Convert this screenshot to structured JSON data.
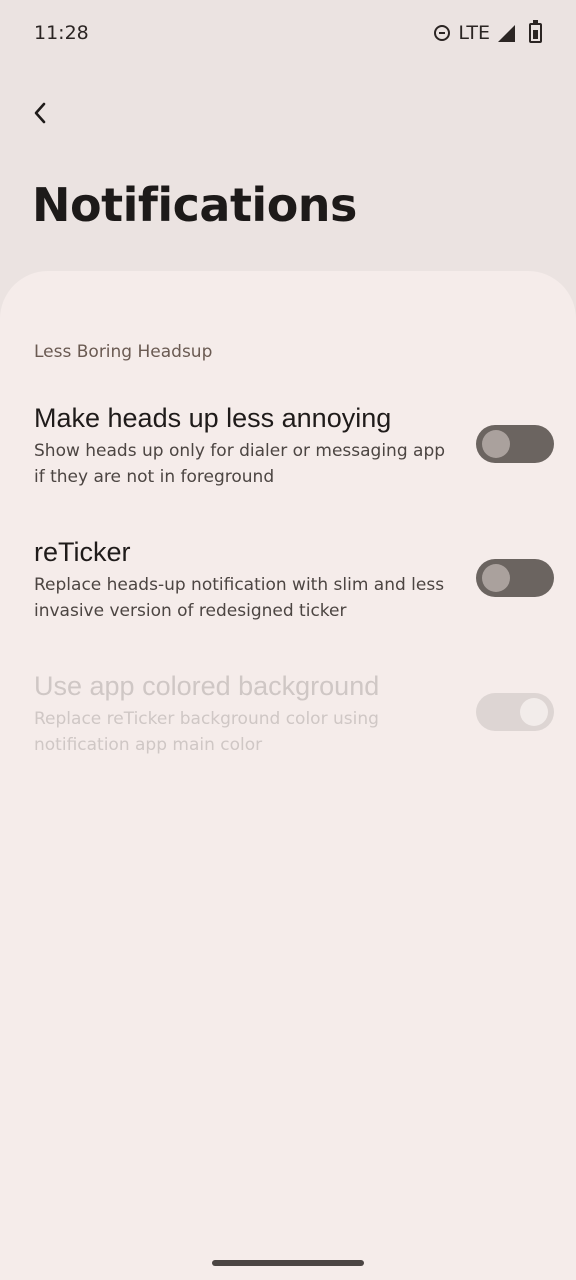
{
  "status_bar": {
    "time": "11:28",
    "network": "LTE"
  },
  "header": {
    "title": "Notifications"
  },
  "section": {
    "header": "Less Boring Headsup"
  },
  "settings": [
    {
      "title": "Make heads up less annoying",
      "description": "Show heads up only for dialer or messaging app if they are not in foreground",
      "enabled": true,
      "checked": false
    },
    {
      "title": "reTicker",
      "description": "Replace heads-up notification with slim and less invasive version of redesigned ticker",
      "enabled": true,
      "checked": false
    },
    {
      "title": "Use app colored background",
      "description": "Replace reTicker background color using notification app main color",
      "enabled": false,
      "checked": true
    }
  ],
  "colors": {
    "background": "#ebe3e1",
    "sheet": "#f5ecea",
    "section_header": "#6a5a52",
    "toggle_off_track": "#6b6460",
    "toggle_disabled_track": "#ddd5d3"
  }
}
